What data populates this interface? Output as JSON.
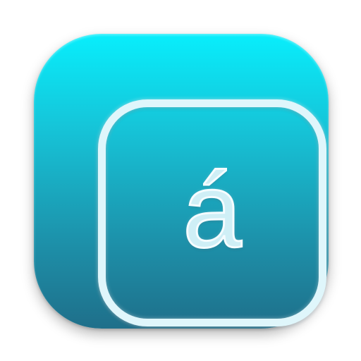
{
  "app_icon": {
    "glyph": "á",
    "colors": {
      "gradient_top": "#08eefc",
      "gradient_bottom": "#1f6f8a",
      "frame": "#dff6fb",
      "glyph_fill": "#cfeff6"
    },
    "icon": "accented-letter-key-icon"
  }
}
